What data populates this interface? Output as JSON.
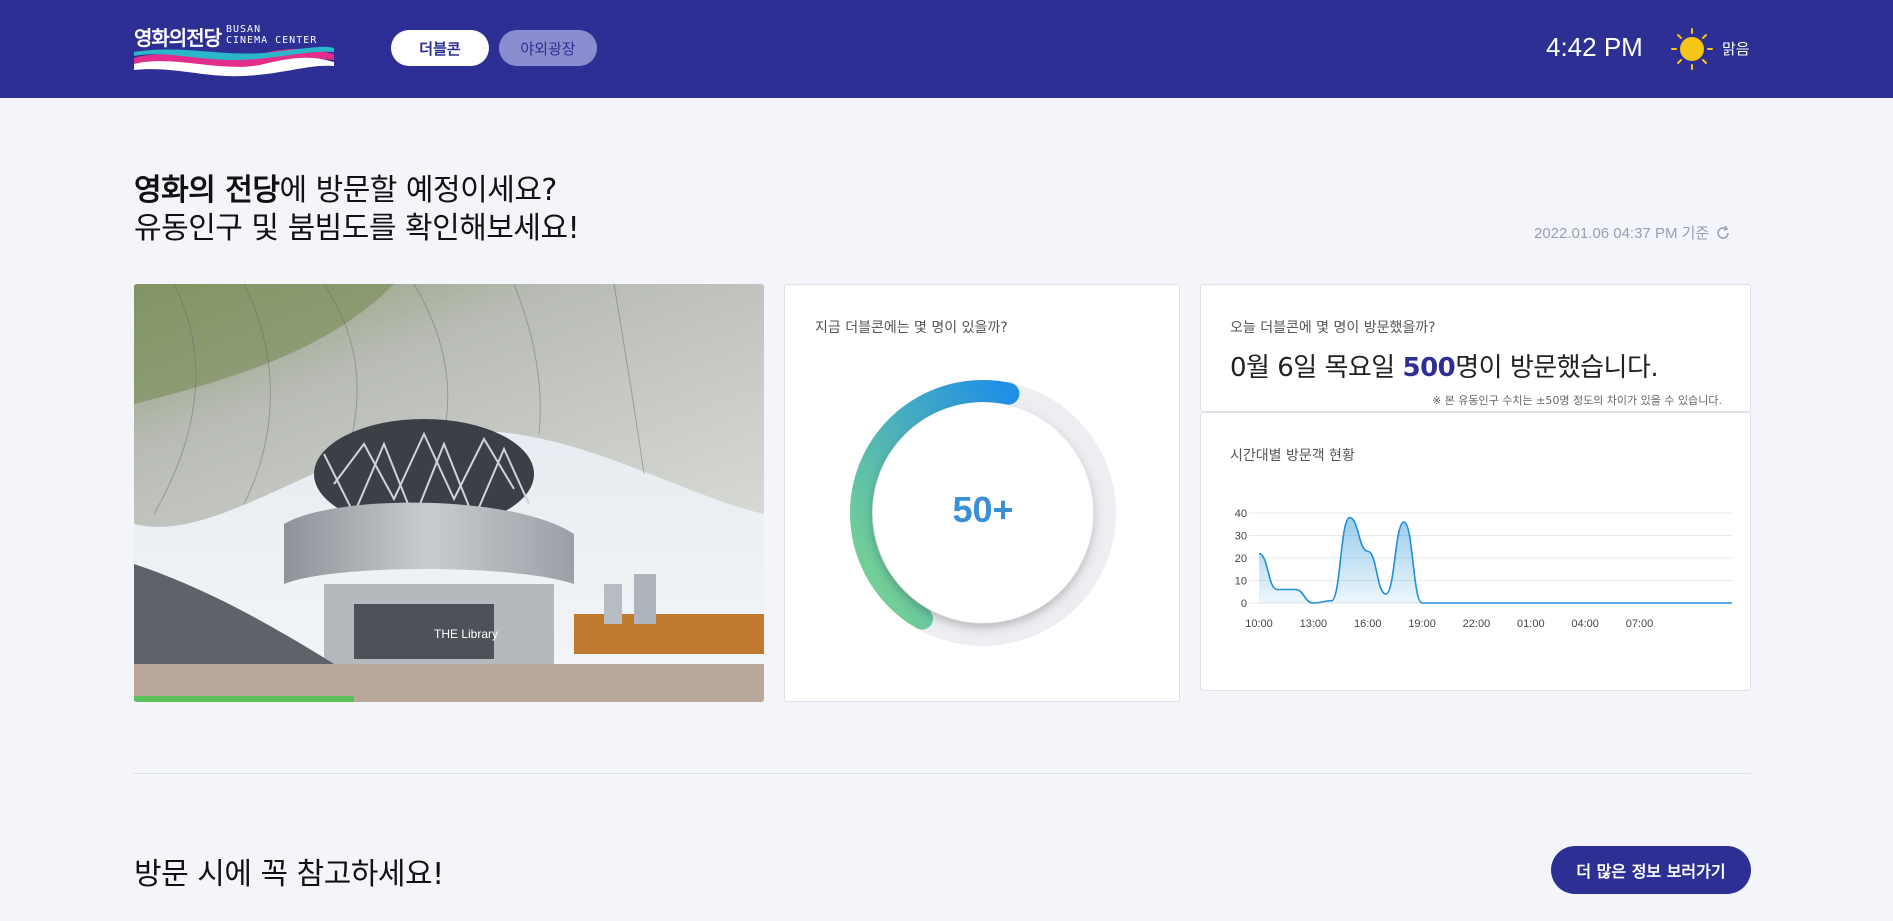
{
  "header": {
    "logo_ko": "영화의전당",
    "logo_en_line1": "BUSAN",
    "logo_en_line2": "CINEMA CENTER",
    "tabs": [
      {
        "label": "더블콘",
        "active": true
      },
      {
        "label": "야외광장",
        "active": false
      }
    ],
    "time": "4:42 PM",
    "weather": {
      "label": "맑음",
      "icon": "sun-icon"
    }
  },
  "headline": {
    "line1_bold": "영화의 전당",
    "line1_rest": "에 방문할 예정이세요?",
    "line2": "유동인구 및 붐빔도를 확인해보세요!"
  },
  "timestamp": "2022.01.06 04:37 PM 기준",
  "now_card": {
    "label": "지금 더블콘에는 몇 명이 있을까?",
    "value": "50+",
    "gauge_level": 0.45
  },
  "today_card": {
    "label": "오늘 더블콘에 몇 명이 방문했을까?",
    "prefix": "0월 6일 목요일 ",
    "count": "500",
    "suffix": "명이 방문했습니다.",
    "note": "※ 본 유동인구 수치는 ±50명 정도의 차이가 있을 수 있습니다."
  },
  "chart_card": {
    "label": "시간대별 방문객 현황"
  },
  "chart_data": {
    "type": "area",
    "title": "",
    "x": [
      "10:00",
      "11:00",
      "12:00",
      "13:00",
      "14:00",
      "15:00",
      "16:00",
      "17:00",
      "18:00",
      "19:00",
      "20:00",
      "21:00",
      "22:00",
      "23:00",
      "00:00",
      "01:00",
      "02:00",
      "03:00",
      "04:00",
      "05:00",
      "06:00",
      "07:00",
      "08:00",
      "09:00"
    ],
    "x_ticks": [
      "10:00",
      "13:00",
      "16:00",
      "19:00",
      "22:00",
      "01:00",
      "04:00",
      "07:00"
    ],
    "series": [
      {
        "values": [
          22,
          6,
          6,
          0,
          1,
          38,
          23,
          4,
          36,
          0,
          0,
          0,
          0,
          0,
          0,
          0,
          0,
          0,
          0,
          0,
          0,
          0,
          0,
          0
        ]
      }
    ],
    "ylim": [
      0,
      40
    ],
    "y_ticks": [
      0,
      10,
      20,
      30,
      40
    ],
    "grid": true,
    "color": "#1f8fd6"
  },
  "bottom": {
    "title": "방문 시에 꼭 참고하세요!",
    "more_button": "더 많은 정보 보러가기"
  }
}
